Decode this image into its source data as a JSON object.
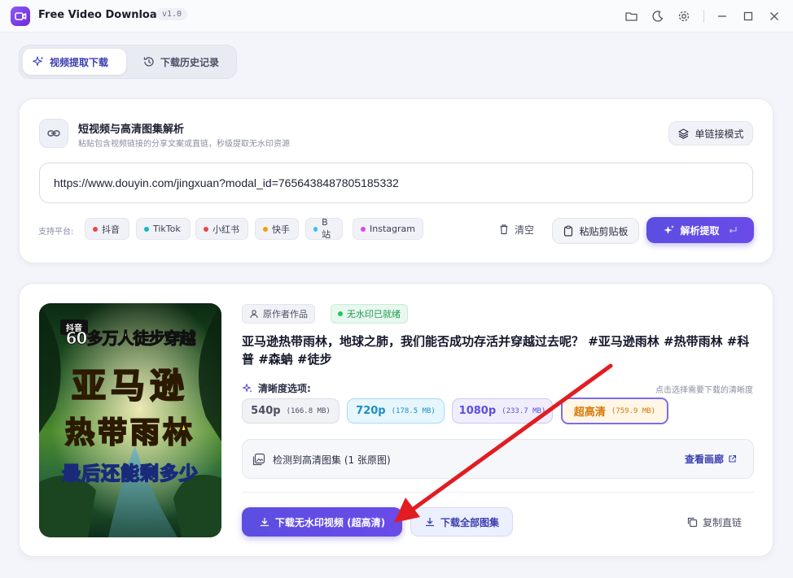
{
  "app": {
    "title": "Free Video Downloader",
    "version": "v1.0"
  },
  "tabs": [
    {
      "label": "视频提取下载",
      "active": true
    },
    {
      "label": "下载历史记录",
      "active": false
    }
  ],
  "input_section": {
    "title": "短视频与高清图集解析",
    "subtitle": "粘贴包含视频链接的分享文案或直链，秒级提取无水印资源",
    "mode_button": "单链接模式",
    "url_value": "https://www.douyin.com/jingxuan?modal_id=7656438487805185332",
    "platforms_label": "支持平台:",
    "platforms": [
      {
        "name": "抖音",
        "color": "#ef4444"
      },
      {
        "name": "TikTok",
        "color": "#14b8c4"
      },
      {
        "name": "小红书",
        "color": "#ef4444"
      },
      {
        "name": "快手",
        "color": "#f59e0b"
      },
      {
        "name": "B站",
        "color": "#38bdf8"
      },
      {
        "name": "Instagram",
        "color": "#d946ef"
      }
    ],
    "clear_label": "清空",
    "paste_label": "粘贴剪贴板",
    "parse_label": "解析提取"
  },
  "result": {
    "thumbnail": {
      "badge": "抖音",
      "line1": "60多万人徒步穿越",
      "line2": "亚马逊",
      "line3": "热带雨林",
      "line4": "最后还能剩多少"
    },
    "tag_original": "原作者作品",
    "tag_nowatermark": "无水印已就绪",
    "title": "亚马逊热带雨林，地球之肺，我们能否成功存活并穿越过去呢？ #亚马逊雨林 #热带雨林 #科普 #森蚺 #徒步",
    "quality_label": "清晰度选项:",
    "quality_hint": "点击选择需要下载的清晰度",
    "qualities": [
      {
        "name": "540p",
        "size": "(166.8 MB)"
      },
      {
        "name": "720p",
        "size": "(178.5 MB)"
      },
      {
        "name": "1080p",
        "size": "(233.7 MB)"
      },
      {
        "name": "超高清",
        "size": "(759.9 MB)"
      }
    ],
    "gallery_text": "检测到高清图集 (1 张原图)",
    "gallery_link": "查看画廊",
    "download_video": "下载无水印视频 (超高清)",
    "download_gallery": "下载全部图集",
    "copy_link": "复制直链"
  }
}
